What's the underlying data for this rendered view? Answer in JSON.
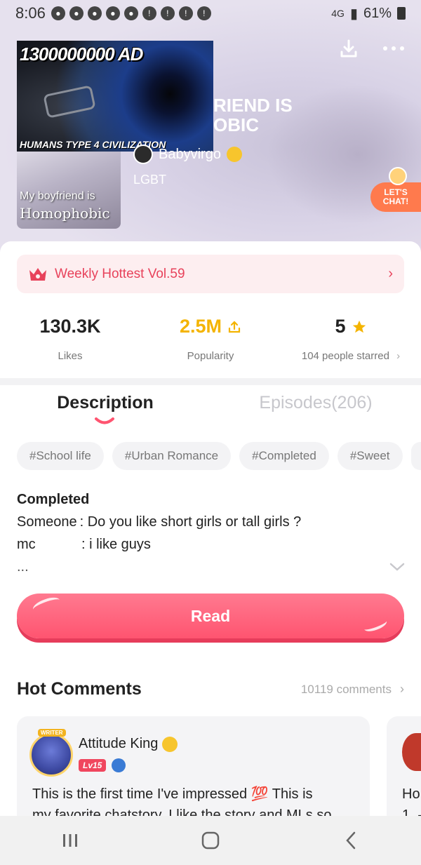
{
  "status_bar": {
    "time": "8:06",
    "battery": "61%",
    "network": "4G"
  },
  "header": {
    "download_icon": "download-icon",
    "more_icon": "more-dots-icon"
  },
  "overlay_thumbnail": {
    "title": "1300000000 AD",
    "subtitle": "HUMANS TYPE 4 CIVILIZATION"
  },
  "comic": {
    "cover_line1": "My boyfriend is",
    "cover_line2": "Homophobic",
    "title_fragment_line1": "RIEND IS",
    "title_fragment_line2": "OBIC",
    "author": "Babyvirgo",
    "genre": "LGBT"
  },
  "chat_badge": {
    "label": "LET'S CHAT!"
  },
  "ranking": {
    "label": "Weekly Hottest Vol.59"
  },
  "stats": {
    "likes_value": "130.3K",
    "likes_label": "Likes",
    "popularity_value": "2.5M",
    "popularity_label": "Popularity",
    "stars_value": "5",
    "stars_label": "104 people starred"
  },
  "tabs": {
    "description": "Description",
    "episodes": "Episodes(206)"
  },
  "tags": [
    "#School life",
    "#Urban Romance",
    "#Completed",
    "#Sweet"
  ],
  "description": {
    "status": "Completed",
    "line1_speaker": "Someone",
    "line1_text": ": Do you like short girls or tall girls ?",
    "line2_speaker": "mc",
    "line2_text": ": i like guys",
    "more": "..."
  },
  "read_button": {
    "label": "Read"
  },
  "hot_comments": {
    "title": "Hot Comments",
    "count": "10119 comments",
    "first": {
      "writer_badge": "WRITER",
      "name": "Attitude King",
      "level": "Lv15",
      "text_line1": "This is the first time I've impressed 💯 This is",
      "text_line2": "my favorite chatstory. I like the story and MLs so"
    },
    "second": {
      "text_line1": "Ho",
      "text_line2": "1. -"
    }
  },
  "colors": {
    "accent_pink": "#ff5470",
    "gold": "#f4b400",
    "ranking_red": "#e8425b"
  }
}
